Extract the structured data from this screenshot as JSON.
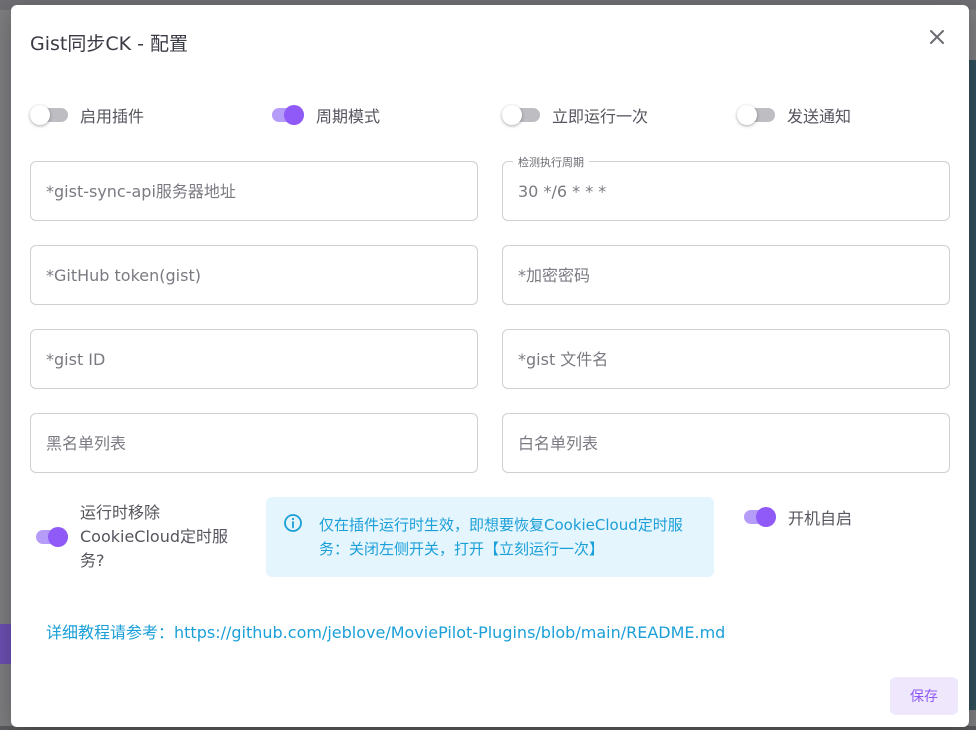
{
  "dialog": {
    "title": "Gist同步CK - 配置"
  },
  "switches": [
    {
      "label": "启用插件",
      "on": false
    },
    {
      "label": "周期模式",
      "on": true
    },
    {
      "label": "立即运行一次",
      "on": false
    },
    {
      "label": "发送通知",
      "on": false
    }
  ],
  "fields": {
    "api_server": {
      "placeholder": "*gist-sync-api服务器地址",
      "value": ""
    },
    "cron": {
      "label": "检测执行周期",
      "placeholder": "30 */6 * * *",
      "value": ""
    },
    "github_token": {
      "placeholder": "*GitHub token(gist)",
      "value": ""
    },
    "encrypt_password": {
      "placeholder": "*加密密码",
      "value": ""
    },
    "gist_id": {
      "placeholder": "*gist ID",
      "value": ""
    },
    "gist_filename": {
      "placeholder": "*gist 文件名",
      "value": ""
    },
    "blacklist": {
      "placeholder": "黑名单列表",
      "value": ""
    },
    "whitelist": {
      "placeholder": "白名单列表",
      "value": ""
    }
  },
  "remove_cookiecloud": {
    "label": "运行时移除CookieCloud定时服务?",
    "on": true
  },
  "alert": {
    "text": "仅在插件运行时生效，即想要恢复CookieCloud定时服务：关闭左侧开关，打开【立刻运行一次】"
  },
  "autostart": {
    "label": "开机自启",
    "on": true
  },
  "docs": {
    "prefix": "详细教程请参考：",
    "url": "https://github.com/jeblove/MoviePilot-Plugins/blob/main/README.md"
  },
  "actions": {
    "save_label": "保存"
  },
  "colors": {
    "accent": "#8f5af7",
    "info": "#1a9fd8",
    "info_bg": "#e5f5fd"
  }
}
